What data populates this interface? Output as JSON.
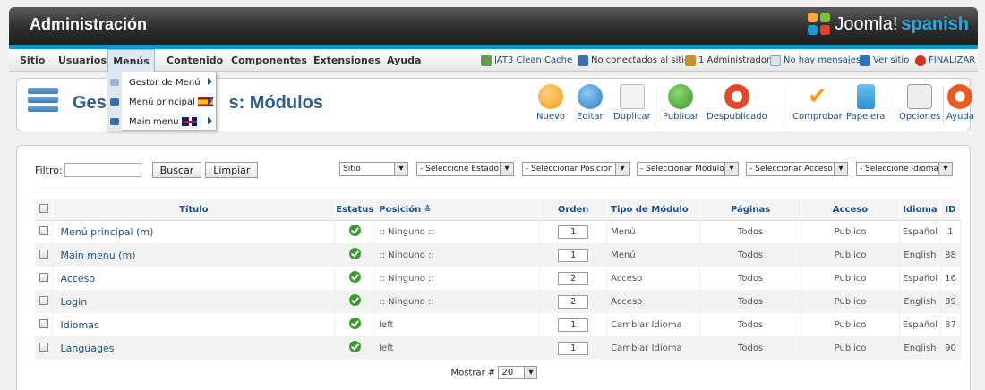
{
  "header": {
    "title": "Administración",
    "logo_text": "Joomla!",
    "logo_suffix": "spanish"
  },
  "menubar": {
    "items": [
      "Sitio",
      "Usuarios",
      "Menús",
      "Contenido",
      "Componentes",
      "Extensiones",
      "Ayuda"
    ],
    "status": {
      "cache": "JAT3 Clean Cache",
      "visitors": "No conectados al sitio",
      "admins": "1 Administrador",
      "messages": "No hay mensajes",
      "view_site": "Ver sitio",
      "logout": "FINALIZAR"
    }
  },
  "dropdown": {
    "items": [
      {
        "label": "Gestor de Menú",
        "flag": ""
      },
      {
        "label": "Menú principal",
        "flag": "es"
      },
      {
        "label": "Main menu",
        "flag": "uk"
      }
    ]
  },
  "toolbar": {
    "page_title_prefix": "Gest",
    "page_title_suffix": "s: Módulos",
    "buttons": [
      "Nuevo",
      "Editar",
      "Duplicar",
      "Publicar",
      "Despublicado",
      "Comprobar",
      "Papelera",
      "Opciones",
      "Ayuda"
    ]
  },
  "filters": {
    "label": "Filtro:",
    "search_value": "",
    "buscar": "Buscar",
    "limpiar": "Limpiar",
    "selects": [
      "Sitio",
      "- Seleccione Estado -",
      "- Seleccionar Posición -",
      "- Seleccionar Módulo -",
      "- Seleccionar Acceso -",
      "- Seleccione Idioma -"
    ]
  },
  "table": {
    "headers": [
      "Título",
      "Estatus",
      "Posición",
      "Orden",
      "Tipo de Módulo",
      "Páginas",
      "Acceso",
      "Idioma",
      "ID"
    ],
    "rows": [
      {
        "title": "Menú principal (m)",
        "position": ":: Ninguno ::",
        "order": "1",
        "type": "Menú",
        "pages": "Todos",
        "access": "Publico",
        "lang": "Español",
        "id": "1"
      },
      {
        "title": "Main menu (m)",
        "position": ":: Ninguno ::",
        "order": "1",
        "type": "Menú",
        "pages": "Todos",
        "access": "Publico",
        "lang": "English",
        "id": "88"
      },
      {
        "title": "Acceso",
        "position": ":: Ninguno ::",
        "order": "2",
        "type": "Acceso",
        "pages": "Todos",
        "access": "Publico",
        "lang": "Español",
        "id": "16"
      },
      {
        "title": "Login",
        "position": ":: Ninguno ::",
        "order": "2",
        "type": "Acceso",
        "pages": "Todos",
        "access": "Publico",
        "lang": "English",
        "id": "89"
      },
      {
        "title": "Idiomas",
        "position": "left",
        "order": "1",
        "type": "Cambiar Idioma",
        "pages": "Todos",
        "access": "Publico",
        "lang": "Español",
        "id": "87"
      },
      {
        "title": "Languages",
        "position": "left",
        "order": "1",
        "type": "Cambiar Idioma",
        "pages": "Todos",
        "access": "Publico",
        "lang": "English",
        "id": "90"
      }
    ]
  },
  "pager": {
    "label": "Mostrar #",
    "value": "20"
  }
}
